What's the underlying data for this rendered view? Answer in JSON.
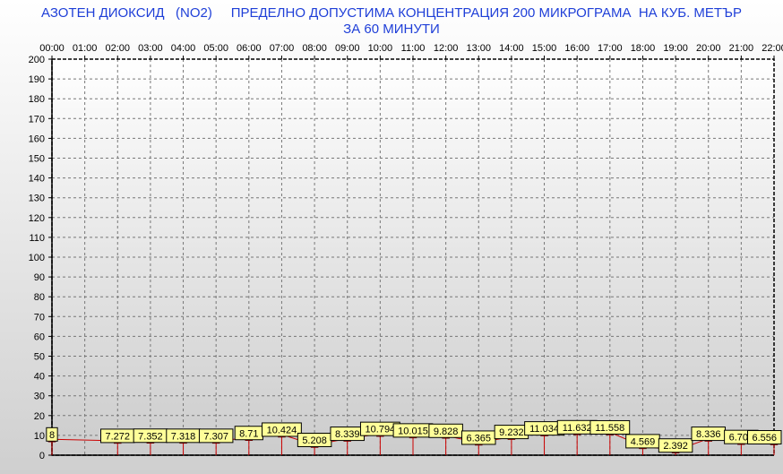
{
  "chart_data": {
    "type": "line",
    "title": "АЗОТЕН ДИОКСИД   (NO2)     ПРЕДЕЛНО ДОПУСТИМА КОНЦЕНТРАЦИЯ 200 МИКРОГРАМА  НА КУБ. МЕТЪР\nЗА 60 МИНУТИ",
    "xlabel": "",
    "ylabel": "",
    "ylim": [
      0,
      200
    ],
    "yticks": [
      0,
      10,
      20,
      30,
      40,
      50,
      60,
      70,
      80,
      90,
      100,
      110,
      120,
      130,
      140,
      150,
      160,
      170,
      180,
      190,
      200
    ],
    "x_ticks": [
      "00:00",
      "01:00",
      "02:00",
      "03:00",
      "04:00",
      "05:00",
      "06:00",
      "07:00",
      "08:00",
      "09:00",
      "10:00",
      "11:00",
      "12:00",
      "13:00",
      "14:00",
      "15:00",
      "16:00",
      "17:00",
      "18:00",
      "19:00",
      "20:00",
      "21:00",
      "22:00"
    ],
    "grid": true,
    "colors": {
      "line": "#cc0000",
      "marker": "#cc0000",
      "label_bg": "#ffff99",
      "title": "#1f3fd8"
    },
    "series": [
      {
        "points": [
          {
            "x": "00:00",
            "y": 8,
            "label": "8"
          },
          {
            "x": "02:00",
            "y": 7.272,
            "label": "7.272"
          },
          {
            "x": "03:00",
            "y": 7.352,
            "label": "7.352"
          },
          {
            "x": "04:00",
            "y": 7.318,
            "label": "7.318"
          },
          {
            "x": "05:00",
            "y": 7.307,
            "label": "7.307"
          },
          {
            "x": "06:00",
            "y": 8.71,
            "label": "8.71"
          },
          {
            "x": "07:00",
            "y": 10.424,
            "label": "10.424"
          },
          {
            "x": "08:00",
            "y": 5.208,
            "label": "5.208"
          },
          {
            "x": "09:00",
            "y": 8.339,
            "label": "8.339"
          },
          {
            "x": "10:00",
            "y": 10.794,
            "label": "10.794"
          },
          {
            "x": "11:00",
            "y": 10.015,
            "label": "10.015"
          },
          {
            "x": "12:00",
            "y": 9.828,
            "label": "9.828"
          },
          {
            "x": "13:00",
            "y": 6.365,
            "label": "6.365"
          },
          {
            "x": "14:00",
            "y": 9.232,
            "label": "9.232"
          },
          {
            "x": "15:00",
            "y": 11.034,
            "label": "11.034"
          },
          {
            "x": "16:00",
            "y": 11.632,
            "label": "11.632"
          },
          {
            "x": "17:00",
            "y": 11.558,
            "label": "11.558"
          },
          {
            "x": "18:00",
            "y": 4.569,
            "label": "4.569"
          },
          {
            "x": "19:00",
            "y": 2.392,
            "label": "2.392"
          },
          {
            "x": "20:00",
            "y": 8.336,
            "label": "8.336"
          },
          {
            "x": "21:00",
            "y": 6.703,
            "label": "6.703"
          },
          {
            "x": "22:00",
            "y": 6.556,
            "label": "6.556"
          }
        ]
      }
    ]
  }
}
